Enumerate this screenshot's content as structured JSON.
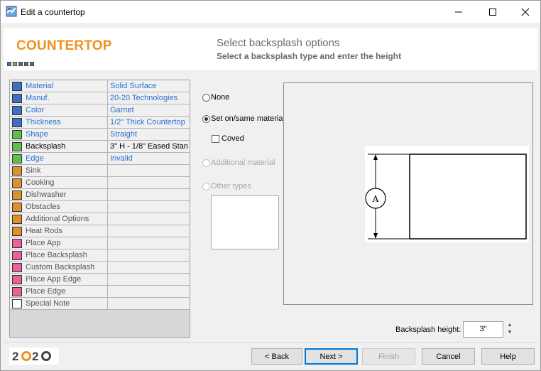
{
  "window": {
    "title": "Edit a countertop"
  },
  "header": {
    "brand": "COUNTERTOP",
    "step_title": "Select backsplash options",
    "step_subtitle": "Select a backsplash type and enter the height"
  },
  "progress_colors": [
    "#3f6fc7",
    "#5fbf4a",
    "#666666",
    "#666666",
    "#666666"
  ],
  "grid": [
    {
      "label": "Material",
      "value": "Solid Surface",
      "color": "#3f6fc7",
      "link": true
    },
    {
      "label": "Manuf.",
      "value": "20-20 Technologies",
      "color": "#3f6fc7",
      "link": true
    },
    {
      "label": "Color",
      "value": "Garnet",
      "color": "#3f6fc7",
      "link": true
    },
    {
      "label": "Thickness",
      "value": "1/2\" Thick Countertop",
      "color": "#3f6fc7",
      "link": true
    },
    {
      "label": "Shape",
      "value": "Straight",
      "color": "#5fbf4a",
      "link": true
    },
    {
      "label": "Backsplash",
      "value": "3\" H - 1/8\" Eased Stan",
      "color": "#5fbf4a",
      "link": false,
      "selected": true
    },
    {
      "label": "Edge",
      "value": "Invalid",
      "color": "#5fbf4a",
      "link": true
    },
    {
      "label": "Sink",
      "value": "",
      "color": "#e0902a",
      "link": false
    },
    {
      "label": "Cooking",
      "value": "",
      "color": "#e0902a",
      "link": false
    },
    {
      "label": "Dishwasher",
      "value": "",
      "color": "#e0902a",
      "link": false
    },
    {
      "label": "Obstacles",
      "value": "",
      "color": "#e0902a",
      "link": false
    },
    {
      "label": "Additional Options",
      "value": "",
      "color": "#e0902a",
      "link": false
    },
    {
      "label": "Heat Rods",
      "value": "",
      "color": "#e0902a",
      "link": false
    },
    {
      "label": "Place App",
      "value": "",
      "color": "#e8629a",
      "link": false
    },
    {
      "label": "Place Backsplash",
      "value": "",
      "color": "#e8629a",
      "link": false
    },
    {
      "label": "Custom Backsplash",
      "value": "",
      "color": "#e8629a",
      "link": false
    },
    {
      "label": "Place App Edge",
      "value": "",
      "color": "#e8629a",
      "link": false
    },
    {
      "label": "Place Edge",
      "value": "",
      "color": "#e8629a",
      "link": false
    },
    {
      "label": "Special Note",
      "value": "",
      "color": "#ffffff",
      "link": false
    }
  ],
  "options": {
    "none": "None",
    "set_on": "Set on/same material",
    "coved": "Coved",
    "additional": "Additional material",
    "other": "Other types"
  },
  "drawing": {
    "dimension_label": "A"
  },
  "height": {
    "label": "Backsplash height:",
    "value": "3\""
  },
  "logo": "2020",
  "buttons": {
    "back": "< Back",
    "next": "Next >",
    "finish": "Finish",
    "cancel": "Cancel",
    "help": "Help"
  }
}
